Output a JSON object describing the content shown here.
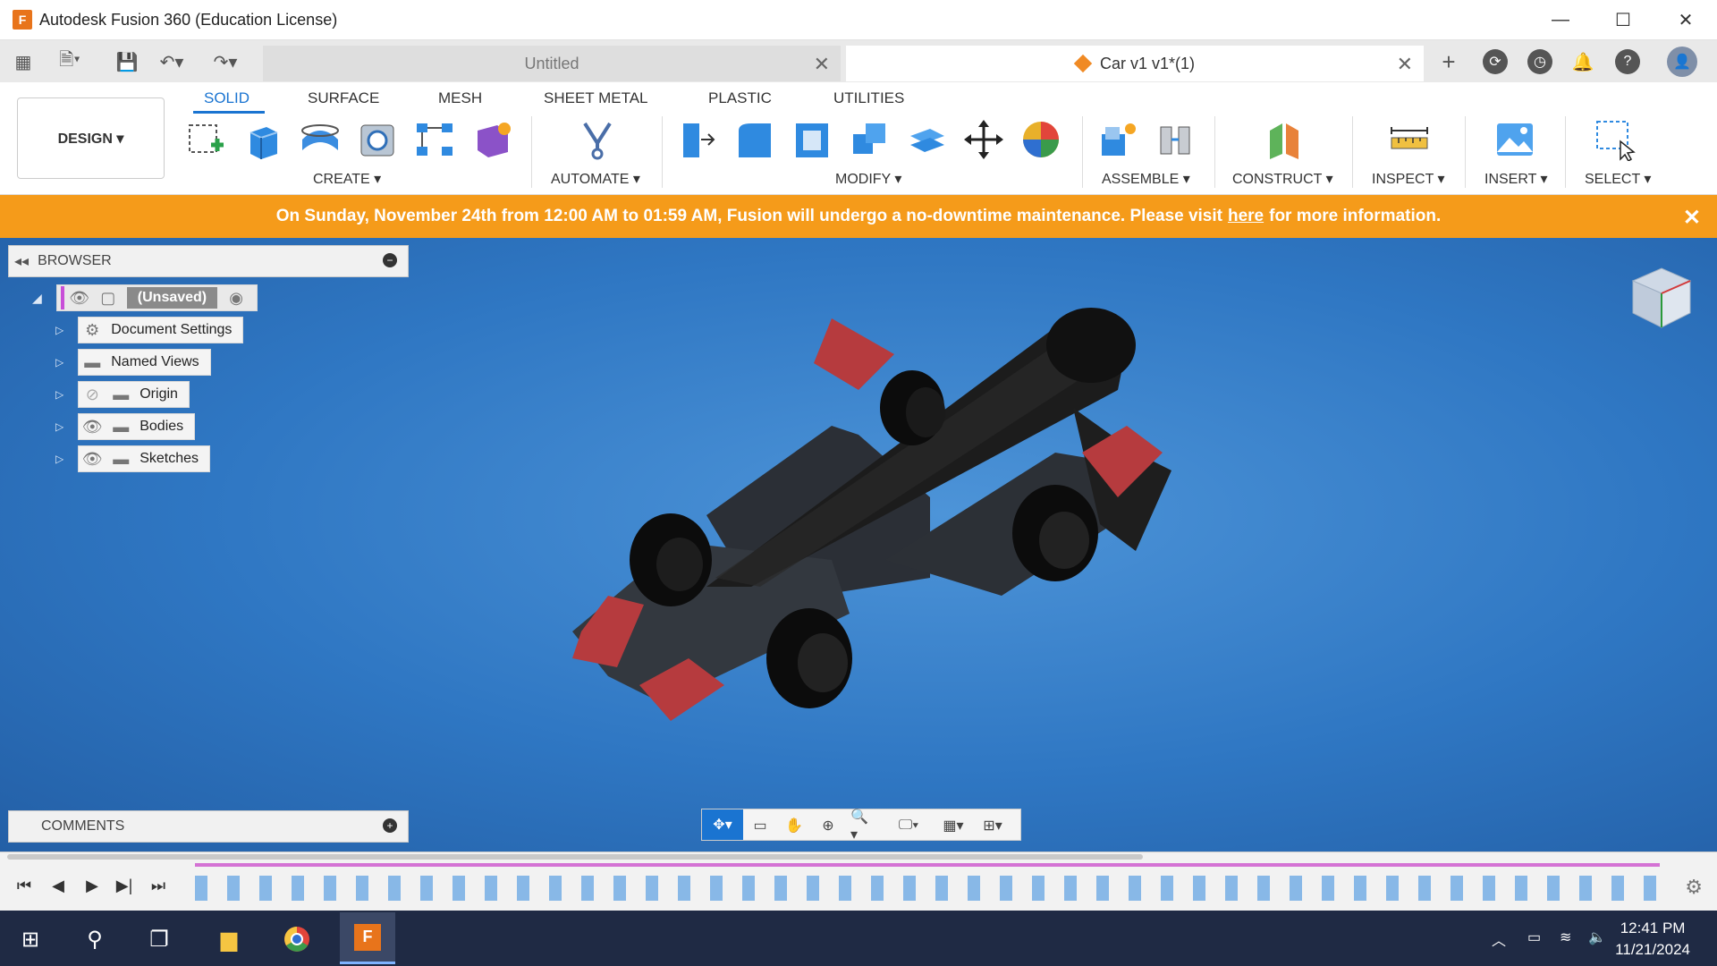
{
  "window": {
    "title": "Autodesk Fusion 360 (Education License)",
    "logo_letter": "F",
    "minimize": "—",
    "maximize": "☐",
    "close": "✕"
  },
  "tabs": [
    {
      "label": "Untitled",
      "active": false
    },
    {
      "label": "Car v1 v1*(1)",
      "active": true
    }
  ],
  "tab_close": "✕",
  "toolbar": {
    "design_label": "DESIGN ▾",
    "tool_tabs": [
      "SOLID",
      "SURFACE",
      "MESH",
      "SHEET METAL",
      "PLASTIC",
      "UTILITIES"
    ],
    "groups": {
      "create": "CREATE ▾",
      "automate": "AUTOMATE ▾",
      "modify": "MODIFY ▾",
      "assemble": "ASSEMBLE ▾",
      "construct": "CONSTRUCT ▾",
      "inspect": "INSPECT ▾",
      "insert": "INSERT ▾",
      "select": "SELECT ▾"
    }
  },
  "banner": {
    "text_before": "On Sunday, November 24th from 12:00 AM to 01:59 AM, Fusion will undergo a no-downtime maintenance. Please visit",
    "link": "here",
    "text_after": "for more information.",
    "close": "✕"
  },
  "browser": {
    "title": "BROWSER",
    "root": "(Unsaved)",
    "items": [
      "Document Settings",
      "Named Views",
      "Origin",
      "Bodies",
      "Sketches"
    ]
  },
  "comments": {
    "title": "COMMENTS"
  },
  "colors": {
    "accent": "#1a74d1",
    "banner": "#f59b1a",
    "viewport": "#2f77c3",
    "body": "#1c1c1c",
    "wing": "#b63b3e"
  },
  "taskbar": {
    "time": "12:41 PM",
    "date": "11/21/2024"
  }
}
